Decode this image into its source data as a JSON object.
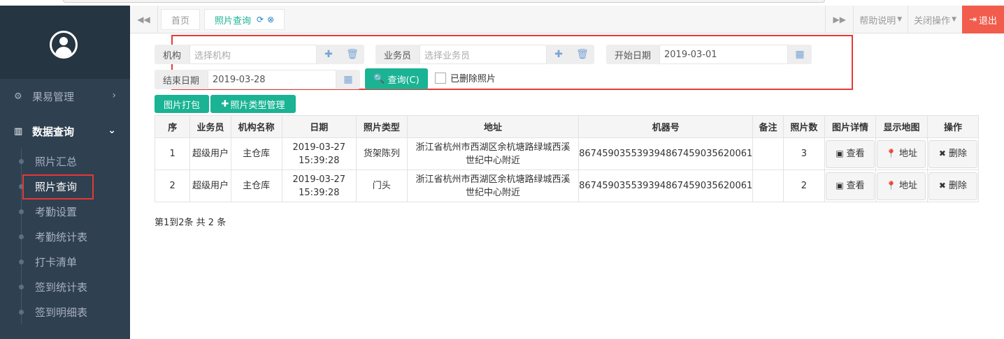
{
  "sidebar": {
    "groups": [
      {
        "label": "果易管理",
        "arrow": "›"
      },
      {
        "label": "数据查询",
        "arrow": "⌄"
      }
    ],
    "items": [
      "照片汇总",
      "照片查询",
      "考勤设置",
      "考勤统计表",
      "打卡清单",
      "签到统计表",
      "签到明细表"
    ]
  },
  "tabs": {
    "back": "◀◀",
    "home": "首页",
    "active": "照片查询",
    "refresh_icon": "⟳",
    "close_icon": "⊗",
    "forward": "▶▶",
    "help": "帮助说明",
    "close_ops": "关闭操作",
    "logout": "退出"
  },
  "form": {
    "org_label": "机构",
    "org_placeholder": "选择机构",
    "staff_label": "业务员",
    "staff_placeholder": "选择业务员",
    "start_label": "开始日期",
    "start_value": "2019-03-01",
    "end_label": "结束日期",
    "end_value": "2019-03-28",
    "query_button": "查询(C)",
    "deleted_checkbox": "已删除照片"
  },
  "toolbar": {
    "pack_button": "图片打包",
    "type_button": "照片类型管理"
  },
  "table": {
    "headers": [
      "序",
      "业务员",
      "机构名称",
      "日期",
      "照片类型",
      "地址",
      "机器号",
      "备注",
      "照片数",
      "图片详情",
      "显示地图",
      "操作"
    ],
    "rows": [
      {
        "no": "1",
        "staff": "超级用户",
        "org": "主仓库",
        "date1": "2019-03-27",
        "date2": "15:39:28",
        "type": "货架陈列",
        "addr1": "浙江省杭州市西湖区余杭塘路绿城西溪",
        "addr2": "世纪中心附近",
        "machine": "867459035539394867459035620061",
        "remark": "",
        "count": "3",
        "view": "查看",
        "map": "地址",
        "del": "删除"
      },
      {
        "no": "2",
        "staff": "超级用户",
        "org": "主仓库",
        "date1": "2019-03-27",
        "date2": "15:39:28",
        "type": "门头",
        "addr1": "浙江省杭州市西湖区余杭塘路绿城西溪",
        "addr2": "世纪中心附近",
        "machine": "867459035539394867459035620061",
        "remark": "",
        "count": "2",
        "view": "查看",
        "map": "地址",
        "del": "删除"
      }
    ]
  },
  "pager": "第1到2条 共 2 条"
}
